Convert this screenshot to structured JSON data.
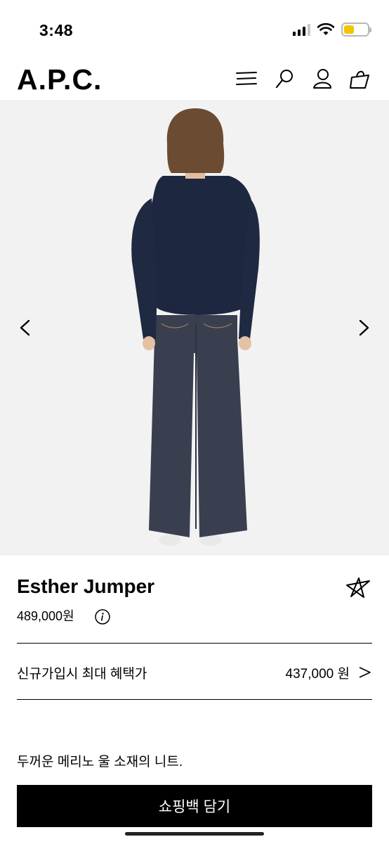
{
  "status_bar": {
    "time": "3:48",
    "battery_color": "#f5c400"
  },
  "header": {
    "logo": "A.P.C.",
    "icons": [
      "menu-icon",
      "search-icon",
      "account-icon",
      "shopping-bag-icon"
    ]
  },
  "hero": {
    "background": "#f2f2f2",
    "prev_icon": "chevron-left-icon",
    "next_icon": "chevron-right-icon"
  },
  "product": {
    "name": "Esther Jumper",
    "price": "489,000원",
    "wishlist_icon": "star-icon",
    "info_icon": "info-icon",
    "benefit": {
      "label": "신규가입시 최대 혜택가",
      "price": "437,000 원",
      "arrow_icon": "chevron-right-icon"
    },
    "description": "두꺼운 메리노 울 소재의 니트."
  },
  "cart_button": {
    "label": "쇼핑백 담기"
  }
}
